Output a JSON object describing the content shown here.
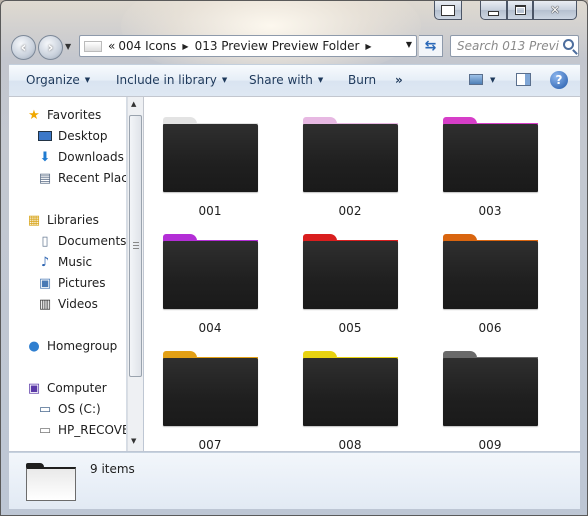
{
  "window": {
    "title": "013 Preview Preview Folder"
  },
  "address": {
    "segments": [
      "004 Icons",
      "013 Preview Preview Folder"
    ],
    "prefix": "«"
  },
  "search": {
    "placeholder": "Search 013 Previ..."
  },
  "toolbar": {
    "organize": "Organize",
    "include_in_library": "Include in library",
    "share_with": "Share with",
    "burn": "Burn",
    "more": "»"
  },
  "nav": {
    "favorites": {
      "label": "Favorites",
      "items": [
        "Desktop",
        "Downloads",
        "Recent Places"
      ]
    },
    "libraries": {
      "label": "Libraries",
      "items": [
        "Documents",
        "Music",
        "Pictures",
        "Videos"
      ]
    },
    "homegroup": "Homegroup",
    "computer": {
      "label": "Computer",
      "items": [
        "OS (C:)",
        "HP_RECOVERY"
      ]
    }
  },
  "folders": [
    {
      "name": "001",
      "color": "#e3e3e3"
    },
    {
      "name": "002",
      "color": "#e7b8e2"
    },
    {
      "name": "003",
      "color": "#d63ec8"
    },
    {
      "name": "004",
      "color": "#b32ed6"
    },
    {
      "name": "005",
      "color": "#d91e1e"
    },
    {
      "name": "006",
      "color": "#d9650f"
    },
    {
      "name": "007",
      "color": "#e3a015"
    },
    {
      "name": "008",
      "color": "#e8d311"
    },
    {
      "name": "009",
      "color": "#6a6a6a"
    }
  ],
  "status": {
    "count": "9 items"
  }
}
